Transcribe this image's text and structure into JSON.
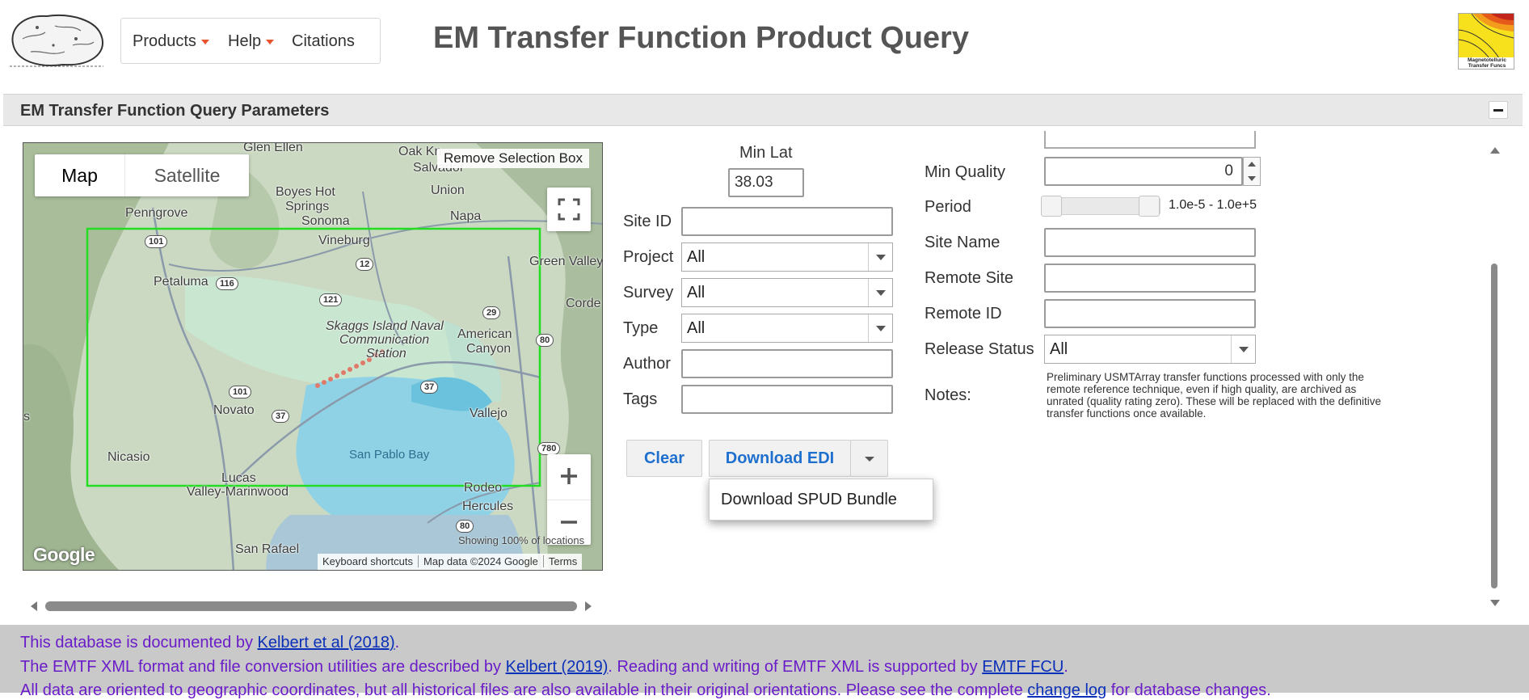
{
  "header": {
    "title": "EM Transfer Function Product Query",
    "nav": [
      {
        "label": "Products",
        "has_caret": true
      },
      {
        "label": "Help",
        "has_caret": true
      },
      {
        "label": "Citations",
        "has_caret": false
      }
    ],
    "right_logo_text": "Magnetotelluric Transfer Funcs"
  },
  "panel": {
    "title": "EM Transfer Function Query Parameters",
    "collapse_icon": "minus-icon"
  },
  "map": {
    "type_buttons": {
      "map": "Map",
      "satellite": "Satellite"
    },
    "selected_type": "Map",
    "remove_selection": "Remove Selection Box",
    "showing": "Showing 100% of locations",
    "footer": {
      "shortcuts": "Keyboard shortcuts",
      "data": "Map data ©2024 Google",
      "terms": "Terms"
    },
    "attribution": "Google",
    "labels": {
      "glen_ellen": "Glen Ellen",
      "oak_knoll": "Oak Kn",
      "salvador": "Salvador",
      "boyes": "Boyes Hot",
      "springs": "Springs",
      "sonoma": "Sonoma",
      "union": "Union",
      "napa": "Napa",
      "penngrove": "Penngrove",
      "vineburg": "Vineburg",
      "green_valley": "Green Valley",
      "petaluma": "Petaluma",
      "skaggs_1": "Skaggs Island Naval",
      "skaggs_2": "Communication",
      "skaggs_3": "Station",
      "american_canyon_1": "American",
      "american_canyon_2": "Canyon",
      "corde": "Corde",
      "novato": "Novato",
      "vallejo": "Vallejo",
      "nicasio": "Nicasio",
      "san_pablo_bay": "San Pablo Bay",
      "lucas_1": "Lucas",
      "lucas_2": "Valley-Marinwood",
      "rodeo": "Rodeo",
      "hercules": "Hercules",
      "san_rafael": "San Rafael",
      "edge_s": "s"
    },
    "shields": {
      "r101a": "101",
      "r12": "12",
      "r116": "116",
      "r121": "121",
      "r29": "29",
      "r80a": "80",
      "r101b": "101",
      "r37a": "37",
      "r37b": "37",
      "r780": "780",
      "r80b": "80"
    },
    "selection_color": "#22dd22"
  },
  "form": {
    "min_lat": {
      "label": "Min Lat",
      "value": "38.03"
    },
    "site_id": {
      "label": "Site ID",
      "value": ""
    },
    "project": {
      "label": "Project",
      "value": "All"
    },
    "survey": {
      "label": "Survey",
      "value": "All"
    },
    "type": {
      "label": "Type",
      "value": "All"
    },
    "author": {
      "label": "Author",
      "value": ""
    },
    "tags": {
      "label": "Tags",
      "value": ""
    },
    "min_quality": {
      "label": "Min Quality",
      "value": "0"
    },
    "period": {
      "label": "Period",
      "range": "1.0e-5 - 1.0e+5"
    },
    "site_name": {
      "label": "Site Name",
      "value": ""
    },
    "remote_site": {
      "label": "Remote Site",
      "value": ""
    },
    "remote_id": {
      "label": "Remote ID",
      "value": ""
    },
    "release_status": {
      "label": "Release Status",
      "value": "All"
    },
    "notes": {
      "label": "Notes:",
      "text": "Preliminary USMTArray transfer functions processed with only the remote reference technique, even if high quality, are archived as unrated (quality rating zero). These will be replaced with the definitive transfer functions once available."
    }
  },
  "actions": {
    "clear": "Clear",
    "download_edi": "Download EDI",
    "menu": [
      "Download SPUD Bundle"
    ]
  },
  "footer": {
    "line1": {
      "pre": "This database is documented by ",
      "link": "Kelbert et al (2018)",
      "post": "."
    },
    "line2": {
      "pre": "The EMTF XML format and file conversion utilities are described by ",
      "link1": "Kelbert (2019)",
      "mid": ". Reading and writing of EMTF XML is supported by ",
      "link2": "EMTF FCU",
      "post": "."
    },
    "line3": {
      "pre": "All data are oriented to geographic coordinates, but all historical files are also available in their original orientations. Please see the complete ",
      "link": "change log",
      "post": " for database changes."
    },
    "text_color": "#6a1cc9",
    "link_color": "#0a2fb8"
  }
}
